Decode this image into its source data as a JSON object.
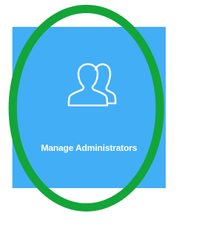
{
  "tile": {
    "label": "Manage Administrators",
    "icon": "users-icon",
    "background_color": "#42aef5",
    "text_color": "#ffffff"
  },
  "annotation": {
    "shape": "ellipse",
    "color": "#13a538"
  }
}
